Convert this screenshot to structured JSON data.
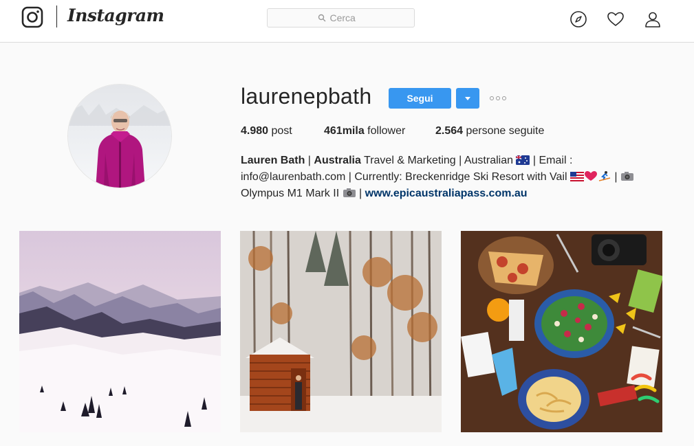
{
  "header": {
    "wordmark": "Instagram",
    "search_placeholder": "Cerca",
    "icons": [
      "instagram-logo-icon",
      "search-icon",
      "compass-icon",
      "heart-icon",
      "profile-icon"
    ]
  },
  "profile": {
    "username": "laurenepbath",
    "follow_label": "Segui",
    "stats": {
      "posts_value": "4.980",
      "posts_label": "post",
      "followers_value": "461mila",
      "followers_label": "follower",
      "following_value": "2.564",
      "following_label": "persone seguite"
    },
    "bio": {
      "name": "Lauren Bath",
      "sep1": " | ",
      "country": "Australia",
      "line1_rest": " Travel & Marketing | Australian ",
      "line1_end": " | Email :",
      "line2_start": "info@laurenbath.com | Currently: Breckenridge Ski Resort with Vail ",
      "line2_end": " | ",
      "line3_start": "Olympus M1 Mark II ",
      "line3_sep": " | ",
      "website": "www.epicaustraliapass.com.au"
    }
  },
  "grid": {
    "photos": [
      {
        "subject": "snowy mountain valley"
      },
      {
        "subject": "wooden cabin in snowy forest"
      },
      {
        "subject": "food spread on table"
      }
    ]
  },
  "colors": {
    "accent": "#3897f0",
    "link": "#003569",
    "text": "#262626",
    "border": "#dbdbdb",
    "background": "#fafafa"
  }
}
